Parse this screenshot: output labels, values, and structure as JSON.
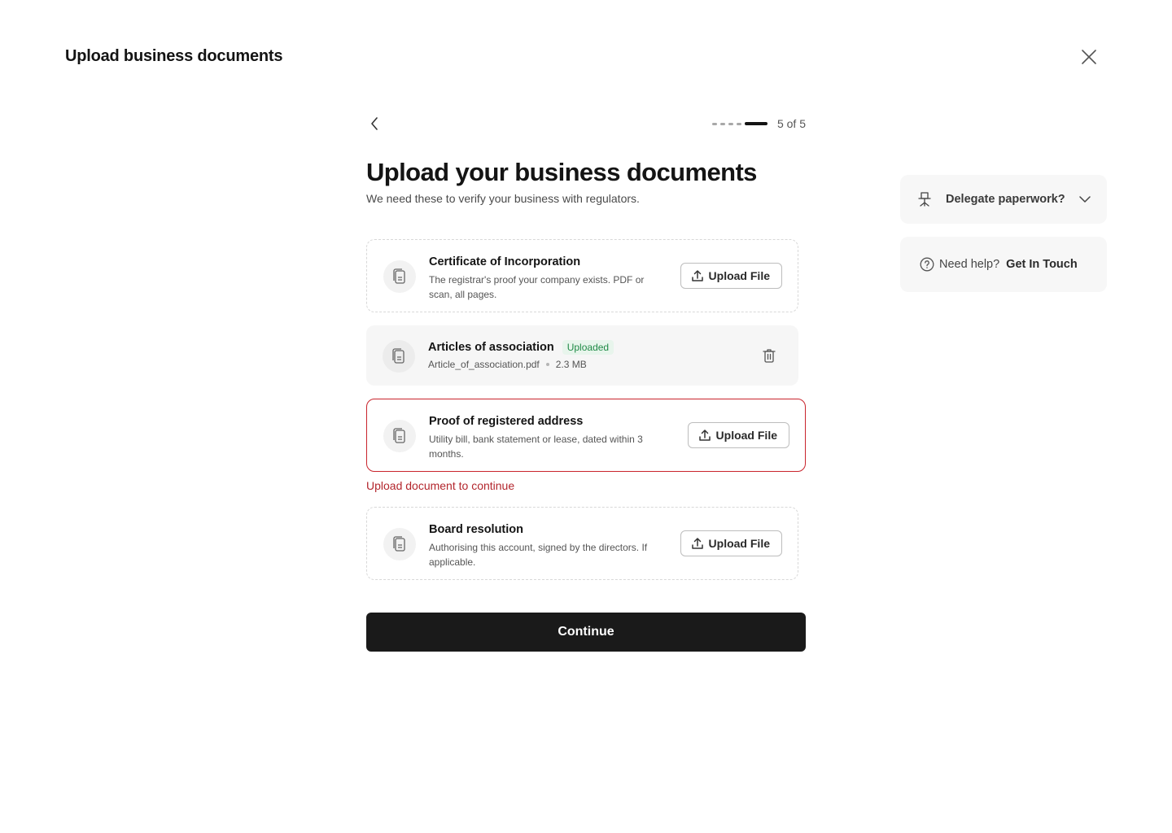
{
  "header": {
    "title": "Upload business documents"
  },
  "progress": {
    "current": 5,
    "total": 5,
    "label": "5 of 5"
  },
  "main": {
    "heading": "Upload your business documents",
    "subheading": "We need these to verify your business with regulators."
  },
  "documents": [
    {
      "title": "Certificate of Incorporation",
      "description": "The registrar's proof your company exists. PDF or scan, all pages.",
      "action": "Upload File",
      "status": "pending"
    },
    {
      "title": "Articles of association",
      "badge": "Uploaded",
      "filename": "Article_of_association.pdf",
      "size": "2.3 MB",
      "status": "uploaded"
    },
    {
      "title": "Proof of registered address",
      "description": "Utility bill, bank statement or lease, dated within 3 months.",
      "action": "Upload File",
      "status": "error",
      "error": "Upload document to continue"
    },
    {
      "title": "Board resolution",
      "description": "Authorising this account, signed by the directors. If applicable.",
      "action": "Upload File",
      "status": "pending"
    }
  ],
  "continue_label": "Continue",
  "side": {
    "delegate_label": "Delegate paperwork?",
    "help_text": "Need help?",
    "help_link": "Get In Touch"
  },
  "icons": {
    "close": "close-icon",
    "back": "chevron-left-icon",
    "document": "document-icon",
    "upload": "upload-icon",
    "trash": "trash-icon",
    "chair": "chair-icon",
    "chevron": "chevron-down-icon",
    "help": "help-circle-icon"
  },
  "colors": {
    "error": "#c9242c",
    "success": "#1f8a46",
    "primary": "#1a1a1a"
  }
}
